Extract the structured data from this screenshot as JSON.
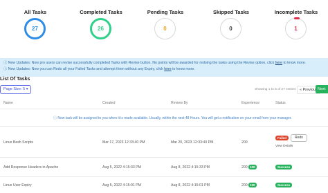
{
  "stats": [
    {
      "id": "all",
      "title": "All Tasks",
      "value": "27"
    },
    {
      "id": "completed",
      "title": "Completed Tasks",
      "value": "26"
    },
    {
      "id": "pending",
      "title": "Pending Tasks",
      "value": "0"
    },
    {
      "id": "skipped",
      "title": "Skipped Tasks",
      "value": "0"
    },
    {
      "id": "incomplete",
      "title": "Incomplete Tasks",
      "value": "1"
    }
  ],
  "notices": [
    {
      "icon": "ⓘ",
      "pre": "New Updates: Now pro users can revise successfully completed Tasks with Revise button. No points will be awarded for redoing the tasks using the Revise option, click ",
      "link": "here",
      "post": " to know more."
    },
    {
      "icon": "ⓘ",
      "pre": "New Updates: Now you can Redo all your Failed Tasks and attempt them without any Expiry, click ",
      "link": "here",
      "post": " to know more."
    }
  ],
  "section_title": "List Of Tasks",
  "page_size_label": "Page Size: 5 ▾",
  "showing_text": "Showing 1 to 5 of 27 entries",
  "prev_label": "« Previous",
  "next_label": "Next",
  "columns": {
    "name": "Name",
    "created": "Created",
    "review_by": "Review By",
    "experience": "Experience",
    "status": "Status"
  },
  "info_message": "ⓘ New task will be assigned to you when it is made available. Usually, within the next 48 Hours. You will get a notification on your email from your manager.",
  "rows": [
    {
      "name": "Linux Bash Scripts",
      "created": "Mar 17, 2023 12:33:40 PM",
      "review_by": "Mar 20, 2023 12:33:40 PM",
      "experience": "200",
      "status": "Failed",
      "redo": "Redo",
      "details": "View Details"
    },
    {
      "name": "Add Response Headers in Apache",
      "created": "Aug 5, 2022 4:15:33 PM",
      "review_by": "Aug 8, 2022 4:15:33 PM",
      "experience": "200",
      "score": "100",
      "status": "Success"
    },
    {
      "name": "Linux User Expiry",
      "created": "Aug 5, 2022 4:15:01 PM",
      "review_by": "Aug 8, 2022 4:15:01 PM",
      "experience": "200",
      "score": "100",
      "status": "Success"
    }
  ]
}
